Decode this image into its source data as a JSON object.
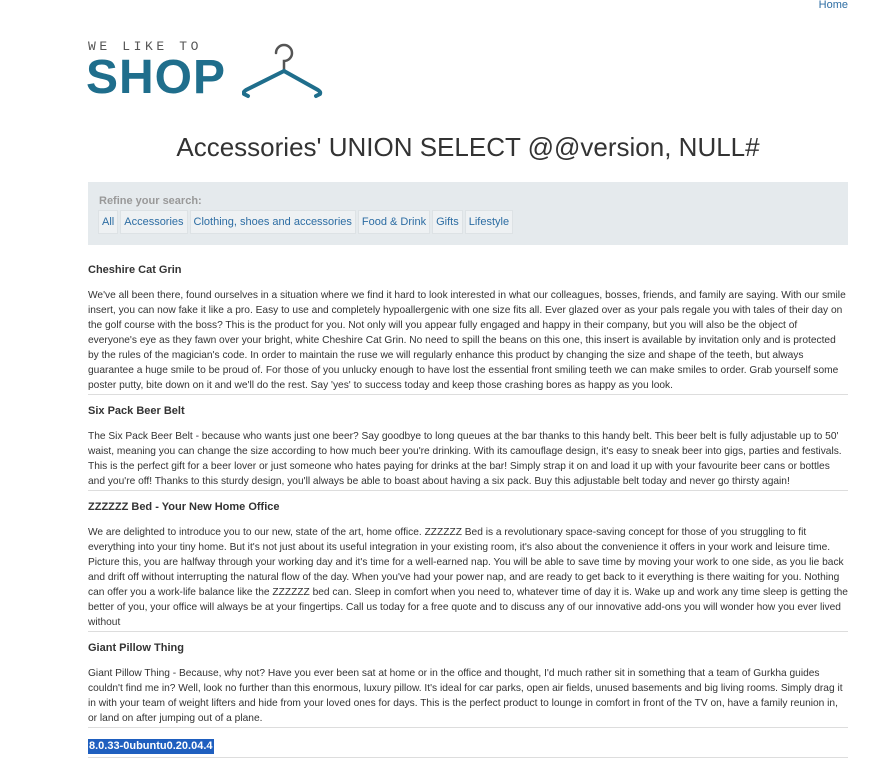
{
  "nav": {
    "home": "Home"
  },
  "logo": {
    "tagline": "WE LIKE TO",
    "word": "SHOP"
  },
  "title": "Accessories' UNION SELECT @@version, NULL#",
  "filter": {
    "label": "Refine your search:",
    "tags": [
      "All",
      "Accessories",
      "Clothing, shoes and accessories",
      "Food & Drink",
      "Gifts",
      "Lifestyle"
    ]
  },
  "products": [
    {
      "name": "Cheshire Cat Grin",
      "description": "We've all been there, found ourselves in a situation where we find it hard to look interested in what our colleagues, bosses, friends, and family are saying. With our smile insert, you can now fake it like a pro. Easy to use and completely hypoallergenic with one size fits all. Ever glazed over as your pals regale you with tales of their day on the golf course with the boss? This is the product for you. Not only will you appear fully engaged and happy in their company, but you will also be the object of everyone's eye as they fawn over your bright, white Cheshire Cat Grin. No need to spill the beans on this one, this insert is available by invitation only and is protected by the rules of the magician's code. In order to maintain the ruse we will regularly enhance this product by changing the size and shape of the teeth, but always guarantee a huge smile to be proud of. For those of you unlucky enough to have lost the essential front smiling teeth we can make smiles to order. Grab yourself some poster putty, bite down on it and we'll do the rest. Say 'yes' to success today and keep those crashing bores as happy as you look."
    },
    {
      "name": "Six Pack Beer Belt",
      "description": "The Six Pack Beer Belt - because who wants just one beer? Say goodbye to long queues at the bar thanks to this handy belt. This beer belt is fully adjustable up to 50' waist, meaning you can change the size according to how much beer you're drinking. With its camouflage design, it's easy to sneak beer into gigs, parties and festivals. This is the perfect gift for a beer lover or just someone who hates paying for drinks at the bar! Simply strap it on and load it up with your favourite beer cans or bottles and you're off! Thanks to this sturdy design, you'll always be able to boast about having a six pack. Buy this adjustable belt today and never go thirsty again!"
    },
    {
      "name": "ZZZZZZ Bed - Your New Home Office",
      "description": "We are delighted to introduce you to our new, state of the art, home office. ZZZZZZ Bed is a revolutionary space-saving concept for those of you struggling to fit everything into your tiny home. But it's not just about its useful integration in your existing room, it's also about the convenience it offers in your work and leisure time. Picture this, you are halfway through your working day and it's time for a well-earned nap. You will be able to save time by moving your work to one side, as you lie back and drift off without interrupting the natural flow of the day. When you've had your power nap, and are ready to get back to it everything is there waiting for you. Nothing can offer you a work-life balance like the ZZZZZZ bed can. Sleep in comfort when you need to, whatever time of day it is. Wake up and work any time sleep is getting the better of you, your office will always be at your fingertips. Call us today for a free quote and to discuss any of our innovative add-ons you will wonder how you ever lived without"
    },
    {
      "name": "Giant Pillow Thing",
      "description": "Giant Pillow Thing - Because, why not? Have you ever been sat at home or in the office and thought, I'd much rather sit in something that a team of Gurkha guides couldn't find me in? Well, look no further than this enormous, luxury pillow. It's ideal for car parks, open air fields, unused basements and big living rooms. Simply drag it in with your team of weight lifters and hide from your loved ones for days. This is the perfect product to lounge in comfort in front of the TV on, have a family reunion in, or land on after jumping out of a plane."
    }
  ],
  "leaked_row": "8.0.33-0ubuntu0.20.04.4"
}
